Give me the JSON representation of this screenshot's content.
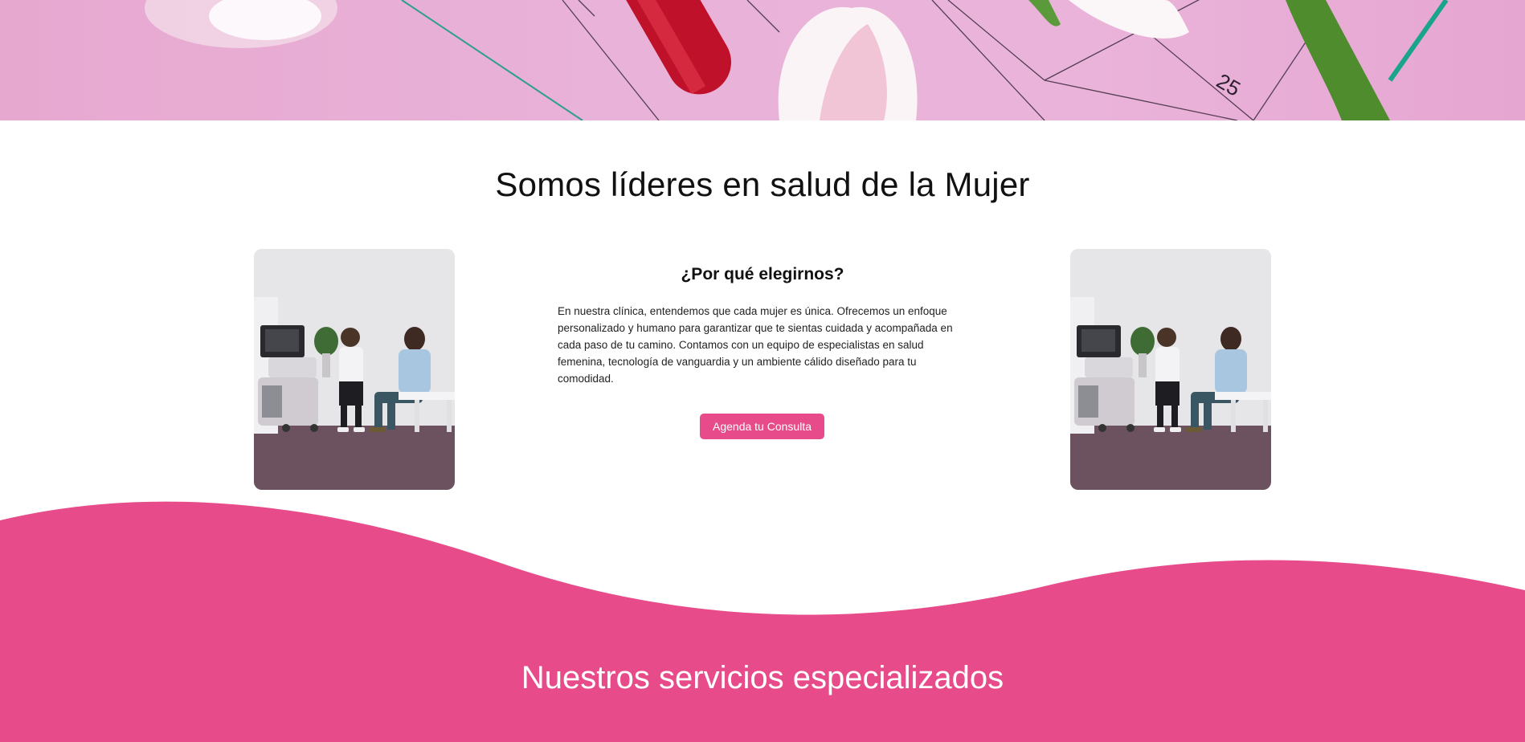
{
  "hero": {
    "calendar_number": "25",
    "image_icon": "flowers-calendar-image"
  },
  "about": {
    "title": "Somos líderes en salud de la Mujer",
    "subtitle": "¿Por qué elegirnos?",
    "text": "En nuestra clínica, entendemos que cada mujer es única. Ofrecemos un enfoque personalizado y humano para garantizar que te sientas cuidada y acompañada en cada paso de tu camino. Contamos con un equipo de especialistas en salud femenina, tecnología de vanguardia y un ambiente cálido diseñado para tu comodidad.",
    "cta_label": "Agenda tu Consulta",
    "photo_icon": "doctor-consultation-photo"
  },
  "services": {
    "title": "Nuestros servicios especializados"
  },
  "colors": {
    "accent": "#e84b89",
    "hero_bg": "#e9b2d8",
    "text": "#111111",
    "background": "#ffffff"
  }
}
